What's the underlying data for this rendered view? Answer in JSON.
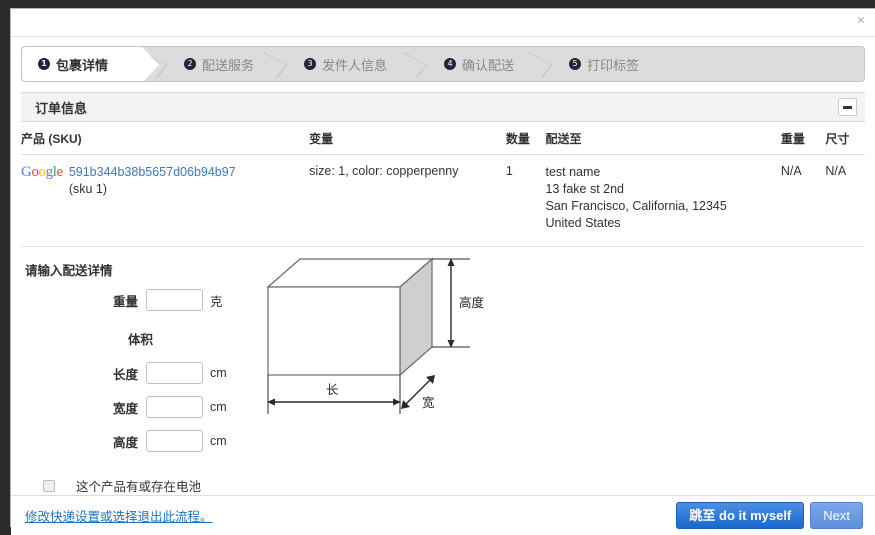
{
  "titlebar": {
    "close_label": "×"
  },
  "steps": [
    {
      "num": "❶",
      "index": "1",
      "label": "包裹详情",
      "active": true
    },
    {
      "num": "2",
      "index": "2",
      "label": "配送服务",
      "active": false
    },
    {
      "num": "3",
      "index": "3",
      "label": "发件人信息",
      "active": false
    },
    {
      "num": "4",
      "index": "4",
      "label": "确认配送",
      "active": false
    },
    {
      "num": "5",
      "index": "5",
      "label": "打印标签",
      "active": false
    }
  ],
  "order_panel": {
    "title": "订单信息",
    "collapse_label": "-"
  },
  "table": {
    "headers": {
      "sku": "产品 (SKU)",
      "variant": "变量",
      "qty": "数量",
      "ship_to": "配送至",
      "weight": "重量",
      "dims": "尺寸"
    },
    "rows": [
      {
        "logo": "Google",
        "sku_link": "591b344b38b5657d06b94b97",
        "sku_sub": "(sku 1)",
        "variant": "size: 1, color: copperpenny",
        "qty": "1",
        "address": [
          "test name",
          "13 fake st 2nd",
          "San Francisco, California, 12345",
          "United States"
        ],
        "weight": "N/A",
        "dims": "N/A"
      }
    ]
  },
  "form": {
    "title": "请输入配送详情",
    "weight_label": "重量",
    "weight_value": "",
    "weight_unit": "克",
    "volume_label": "体积",
    "length_label": "长度",
    "length_value": "",
    "width_label": "宽度",
    "width_value": "",
    "height_label": "高度",
    "height_value": "",
    "cm_unit": "cm",
    "battery_label": "这个产品有或存在电池"
  },
  "diagram": {
    "height_label": "高度",
    "length_label": "长",
    "width_label": "宽"
  },
  "footer": {
    "link": "修改快递设置或选择退出此流程。",
    "primary_button": "跳至 do it myself",
    "secondary_button": "Next"
  },
  "colors": {
    "accent": "#1767cf",
    "link": "#1a73c8",
    "sku_link": "#3b78c3",
    "panel_bg": "#f3f3f3",
    "steps_bg": "#dcdcdc"
  }
}
